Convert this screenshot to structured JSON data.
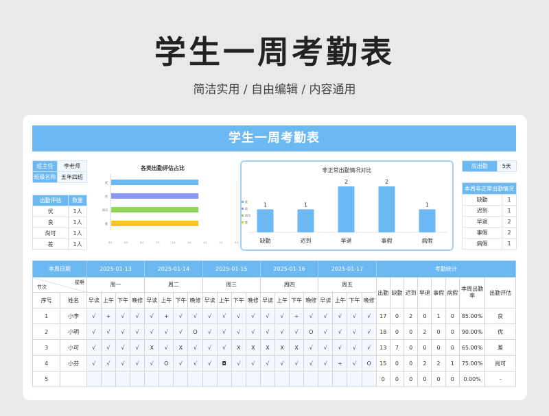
{
  "hero": {
    "title": "学生一周考勤表",
    "subtitle": "简洁实用 / 自由编辑 / 内容通用"
  },
  "sheet": {
    "title": "学生一周考勤表",
    "info": [
      {
        "label": "班主任",
        "value": "李老师"
      },
      {
        "label": "班级名称",
        "value": "五年四班"
      }
    ],
    "eval_header": [
      "出勤评估",
      "数量"
    ],
    "eval_rows": [
      [
        "优",
        "1人"
      ],
      [
        "良",
        "1人"
      ],
      [
        "尚可",
        "1人"
      ],
      [
        "差",
        "1人"
      ]
    ],
    "present": {
      "label": "应出勤",
      "value": "5天"
    },
    "abnormal_title": "本周非正常出勤情况",
    "abnormal_rows": [
      [
        "缺勤",
        "1"
      ],
      [
        "迟到",
        "1"
      ],
      [
        "早退",
        "2"
      ],
      [
        "事假",
        "2"
      ],
      [
        "病假",
        "1"
      ]
    ]
  },
  "bar_chart": {
    "title": "各类出勤评估占比",
    "axis_labels": [
      "0人",
      "0人",
      "0人",
      "1人",
      "1人",
      "1人",
      "1人",
      "1人",
      "2人"
    ],
    "legend": [
      "优",
      "良",
      "尚可",
      "差"
    ]
  },
  "chart_data": [
    {
      "type": "bar",
      "orientation": "horizontal",
      "title": "各类出勤评估占比",
      "categories": [
        "差",
        "尚可",
        "良",
        "优"
      ],
      "series": [
        {
          "name": "差",
          "values": [
            1,
            null,
            null,
            null
          ],
          "color": "#f5c518"
        },
        {
          "name": "尚可",
          "values": [
            null,
            1,
            null,
            null
          ],
          "color": "#8fd65a"
        },
        {
          "name": "良",
          "values": [
            null,
            null,
            1,
            null
          ],
          "color": "#8c97f0"
        },
        {
          "name": "优",
          "values": [
            null,
            null,
            null,
            1
          ],
          "color": "#6cb8f3"
        }
      ],
      "xlim": [
        0,
        2
      ],
      "legend": "right"
    },
    {
      "type": "bar",
      "title": "非正常出勤情况对比",
      "categories": [
        "缺勤",
        "迟到",
        "早退",
        "事假",
        "病假"
      ],
      "values": [
        1,
        1,
        2,
        2,
        1
      ],
      "ylim": [
        0,
        2.2
      ],
      "color": "#6cb8f3"
    }
  ],
  "grid": {
    "week_label": "本周日期",
    "stats_label": "考勤统计",
    "dates": [
      "2025-01-13",
      "2025-01-14",
      "2025-01-15",
      "2025-01-16",
      "2025-01-17"
    ],
    "diag_top": "星期",
    "diag_bottom": "节次",
    "days": [
      "周一",
      "周二",
      "周三",
      "周四",
      "周五"
    ],
    "stat_heads": [
      "出勤",
      "缺勤",
      "迟到",
      "早退",
      "事假",
      "病假"
    ],
    "rate_head": "本周出勤率",
    "eval_head": "出勤评估",
    "no_head": "序号",
    "name_head": "姓名",
    "periods": [
      "早读",
      "上午",
      "下午",
      "晚修"
    ],
    "rows": [
      {
        "no": "1",
        "name": "小李",
        "marks": [
          "√",
          "+",
          "√",
          "√",
          "√",
          "+",
          "√",
          "√",
          "√",
          "√",
          "√",
          "√",
          "√",
          "√",
          "÷",
          "√",
          "√",
          "√",
          "√",
          "√"
        ],
        "stats": [
          "17",
          "0",
          "2",
          "0",
          "1",
          "0"
        ],
        "rate": "85.00%",
        "eval": "良"
      },
      {
        "no": "2",
        "name": "小明",
        "marks": [
          "√",
          "√",
          "√",
          "√",
          "√",
          "√",
          "√",
          "O",
          "√",
          "√",
          "√",
          "√",
          "√",
          "√",
          "√",
          "O",
          "√",
          "√",
          "√",
          "√"
        ],
        "stats": [
          "18",
          "0",
          "0",
          "2",
          "0",
          "0"
        ],
        "rate": "90.00%",
        "eval": "优"
      },
      {
        "no": "3",
        "name": "小可",
        "marks": [
          "√",
          "√",
          "√",
          "√",
          "X",
          "√",
          "X",
          "√",
          "√",
          "√",
          "X",
          "X",
          "X",
          "X",
          "X",
          "√",
          "√",
          "√",
          "√",
          "√"
        ],
        "stats": [
          "13",
          "7",
          "0",
          "0",
          "0",
          "0"
        ],
        "rate": "65.00%",
        "eval": "差"
      },
      {
        "no": "4",
        "name": "小芬",
        "marks": [
          "√",
          "√",
          "√",
          "√",
          "√",
          "O",
          "√",
          "√",
          "√",
          "◘",
          "√",
          "√",
          "√",
          "√",
          "√",
          "√",
          "√",
          "÷",
          "√",
          "O"
        ],
        "stats": [
          "15",
          "0",
          "0",
          "2",
          "2",
          "1"
        ],
        "rate": "75.00%",
        "eval": "尚可"
      },
      {
        "no": "5",
        "name": "",
        "marks": [
          "",
          "",
          "",
          "",
          "",
          "",
          "",
          "",
          "",
          "",
          "",
          "",
          "",
          "",
          "",
          "",
          "",
          "",
          "",
          ""
        ],
        "stats": [
          "0",
          "0",
          "0",
          "0",
          "0",
          "0"
        ],
        "rate": "0.00%",
        "eval": "-"
      }
    ]
  }
}
